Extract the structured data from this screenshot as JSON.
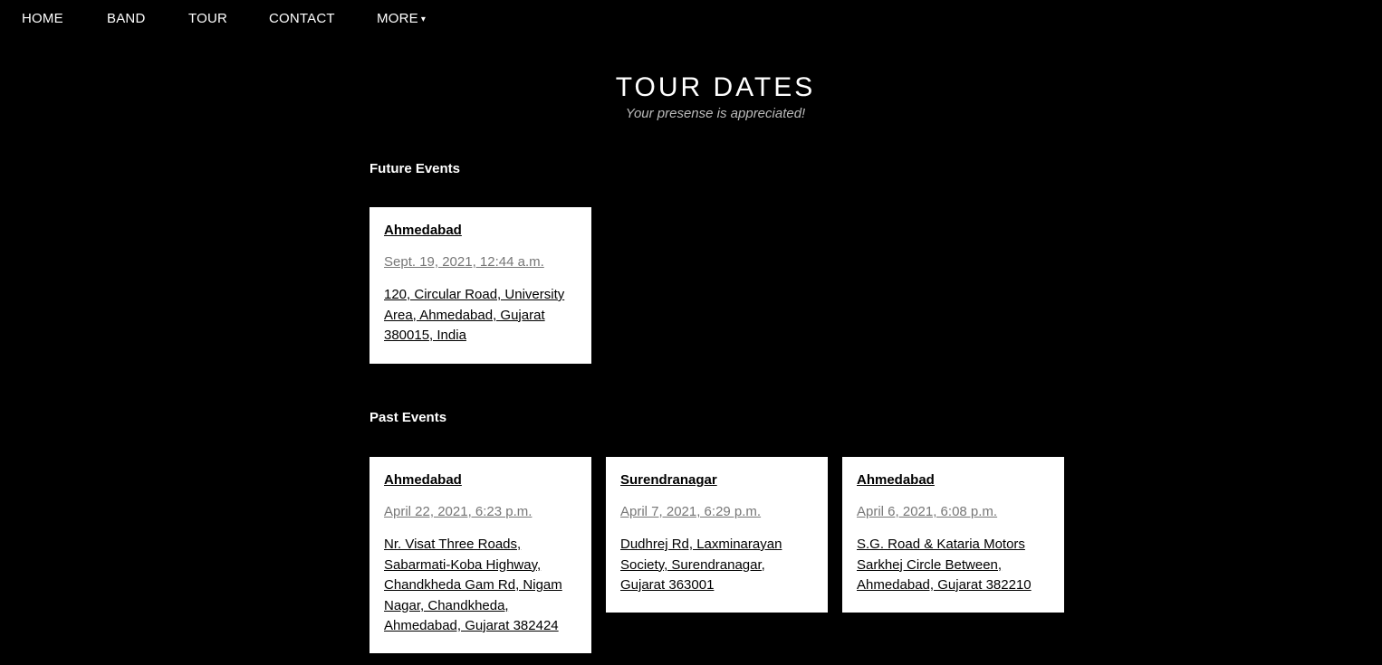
{
  "nav": {
    "items": [
      {
        "label": "HOME"
      },
      {
        "label": "BAND"
      },
      {
        "label": "TOUR"
      },
      {
        "label": "CONTACT"
      },
      {
        "label": "MORE"
      }
    ],
    "more_caret": "▾"
  },
  "page": {
    "title": "TOUR DATES",
    "subtitle": "Your presense is appreciated!"
  },
  "future": {
    "heading": "Future Events",
    "events": [
      {
        "city": "Ahmedabad",
        "date": "Sept. 19, 2021, 12:44 a.m.",
        "address": "120, Circular Road, University Area, Ahmedabad, Gujarat 380015, India"
      }
    ]
  },
  "past": {
    "heading": "Past Events",
    "events": [
      {
        "city": "Ahmedabad",
        "date": "April 22, 2021, 6:23 p.m.",
        "address": "Nr. Visat Three Roads, Sabarmati-Koba Highway, Chandkheda Gam Rd, Nigam Nagar, Chandkheda, Ahmedabad, Gujarat 382424"
      },
      {
        "city": "Surendranagar",
        "date": "April 7, 2021, 6:29 p.m.",
        "address": "Dudhrej Rd, Laxminarayan Society, Surendranagar, Gujarat 363001"
      },
      {
        "city": "Ahmedabad",
        "date": "April 6, 2021, 6:08 p.m.",
        "address": "S.G. Road & Kataria Motors Sarkhej Circle Between, Ahmedabad, Gujarat 382210"
      }
    ]
  }
}
